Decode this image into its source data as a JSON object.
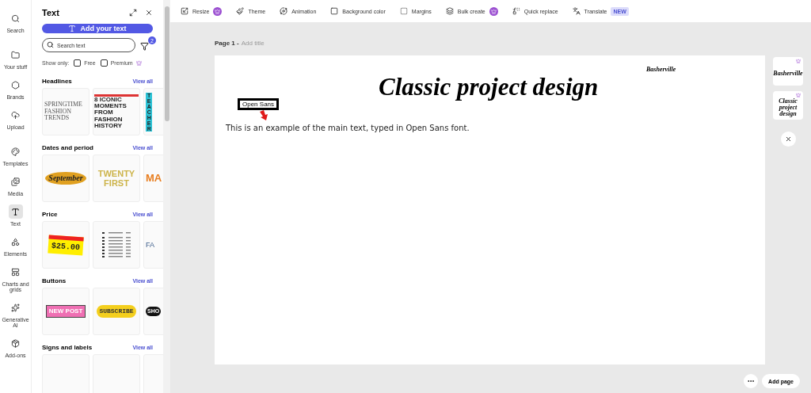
{
  "rail": [
    {
      "label": "Search",
      "selected": false
    },
    {
      "label": "Your stuff",
      "selected": false
    },
    {
      "label": "Brands",
      "selected": false
    },
    {
      "label": "Upload",
      "selected": false
    },
    {
      "label": "Templates",
      "selected": false
    },
    {
      "label": "Media",
      "selected": false
    },
    {
      "label": "Text",
      "selected": true
    },
    {
      "label": "Elements",
      "selected": false
    },
    {
      "label": "Charts and grids",
      "selected": false
    },
    {
      "label": "Generative AI",
      "selected": false
    },
    {
      "label": "Add-ons",
      "selected": false
    }
  ],
  "panel": {
    "title": "Text",
    "add_button": "Add your text",
    "search": {
      "placeholder": "Search text"
    },
    "filter_count": "2",
    "show_only": {
      "label": "Show only:",
      "options": [
        {
          "label": "Free",
          "checked": false,
          "premium": false
        },
        {
          "label": "Premium",
          "checked": false,
          "premium": true
        }
      ]
    },
    "sections": [
      {
        "title": "Headlines",
        "view_all": "View all",
        "items": [
          {
            "kind": "text",
            "text": "SPRINGTIME FASHION TRENDS"
          },
          {
            "kind": "text",
            "text": "8 ICONIC MOMENTS FROM FASHION HISTORY"
          },
          {
            "kind": "text",
            "text": "TEACHER"
          }
        ]
      },
      {
        "title": "Dates and period",
        "view_all": "View all",
        "items": [
          {
            "kind": "text",
            "text": "September"
          },
          {
            "kind": "text",
            "text": "TWENTY FIRST"
          },
          {
            "kind": "text",
            "text": "MA"
          }
        ]
      },
      {
        "title": "Price",
        "view_all": "View all",
        "items": [
          {
            "kind": "text",
            "text": "$25.00"
          },
          {
            "kind": "list"
          },
          {
            "kind": "text",
            "text": "FA"
          }
        ]
      },
      {
        "title": "Buttons",
        "view_all": "View all",
        "items": [
          {
            "kind": "text",
            "text": "NEW POST"
          },
          {
            "kind": "text",
            "text": "SUBSCRIBE"
          },
          {
            "kind": "text",
            "text": "SHO"
          }
        ]
      },
      {
        "title": "Signs and labels",
        "view_all": "View all",
        "items": [
          {
            "kind": "blank"
          },
          {
            "kind": "blank"
          },
          {
            "kind": "blank"
          }
        ]
      }
    ]
  },
  "toolbar": [
    {
      "label": "Resize",
      "premium": true
    },
    {
      "label": "Theme",
      "premium": false
    },
    {
      "label": "Animation",
      "premium": false
    },
    {
      "label": "Background color",
      "premium": false
    },
    {
      "label": "Margins",
      "premium": false
    },
    {
      "label": "Bulk create",
      "premium": true
    },
    {
      "label": "Quick replace",
      "premium": false
    },
    {
      "label": "Translate",
      "premium": false,
      "badge": "NEW"
    }
  ],
  "page": {
    "label": "Page 1 -",
    "title_placeholder": "Add title",
    "heading": "Classic project design",
    "font_note": "Basherville",
    "callout": "Open Sans",
    "body": "This is an example of the main text, typed in Open Sans font."
  },
  "font_suggestions": [
    {
      "text": "Basherville",
      "premium": true
    },
    {
      "text": "Classic project design",
      "premium": true
    }
  ],
  "add_page": "Add page"
}
